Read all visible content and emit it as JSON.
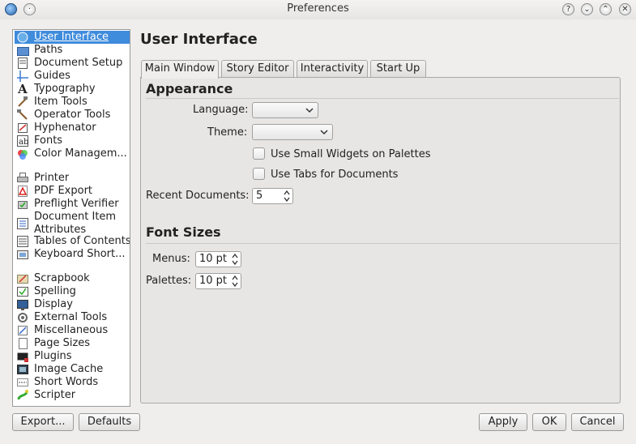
{
  "window": {
    "title": "Preferences",
    "buttons": [
      "?",
      "⌄",
      "⌃",
      "✕"
    ]
  },
  "sidebar": {
    "items": [
      {
        "label": "User Interface",
        "icon": "monitor-icon",
        "selected": true
      },
      {
        "label": "Paths",
        "icon": "folder-icon"
      },
      {
        "label": "Document Setup",
        "icon": "document-icon"
      },
      {
        "label": "Guides",
        "icon": "guides-icon"
      },
      {
        "label": "Typography",
        "icon": "typography-icon"
      },
      {
        "label": "Item Tools",
        "icon": "item-tools-icon"
      },
      {
        "label": "Operator Tools",
        "icon": "operator-tools-icon"
      },
      {
        "label": "Hyphenator",
        "icon": "hyphenator-icon"
      },
      {
        "label": "Fonts",
        "icon": "fonts-icon"
      },
      {
        "label": "Color Managem...",
        "icon": "color-management-icon"
      },
      {
        "label": "Printer",
        "icon": "printer-icon"
      },
      {
        "label": "PDF Export",
        "icon": "pdf-icon"
      },
      {
        "label": "Preflight Verifier",
        "icon": "preflight-icon"
      },
      {
        "label": "Document Item",
        "label2": "Attributes",
        "icon": "attributes-icon"
      },
      {
        "label": "Tables of Contents",
        "icon": "toc-icon"
      },
      {
        "label": "Keyboard Short...",
        "icon": "keyboard-icon"
      },
      {
        "label": "Scrapbook",
        "icon": "scrapbook-icon"
      },
      {
        "label": "Spelling",
        "icon": "spelling-icon"
      },
      {
        "label": "Display",
        "icon": "display-icon"
      },
      {
        "label": "External Tools",
        "icon": "external-tools-icon"
      },
      {
        "label": "Miscellaneous",
        "icon": "miscellaneous-icon"
      },
      {
        "label": "Page Sizes",
        "icon": "page-sizes-icon"
      },
      {
        "label": "Plugins",
        "icon": "plugins-icon"
      },
      {
        "label": "Image Cache",
        "icon": "image-cache-icon"
      },
      {
        "label": "Short Words",
        "icon": "short-words-icon"
      },
      {
        "label": "Scripter",
        "icon": "scripter-icon"
      }
    ]
  },
  "main": {
    "title": "User Interface",
    "tabs": [
      {
        "label": "Main Window",
        "active": true
      },
      {
        "label": "Story Editor"
      },
      {
        "label": "Interactivity"
      },
      {
        "label": "Start Up"
      }
    ],
    "appearance": {
      "title": "Appearance",
      "language_label": "Language:",
      "language_value": "",
      "theme_label": "Theme:",
      "theme_value": "",
      "small_widgets_label": "Use Small Widgets on Palettes",
      "small_widgets_checked": false,
      "tabs_docs_label": "Use Tabs for Documents",
      "tabs_docs_checked": false,
      "recent_label": "Recent Documents:",
      "recent_value": "5"
    },
    "font_sizes": {
      "title": "Font Sizes",
      "menus_label": "Menus:",
      "menus_value": "10 pt",
      "palettes_label": "Palettes:",
      "palettes_value": "10 pt"
    }
  },
  "footer": {
    "export_label": "Export...",
    "defaults_label": "Defaults",
    "apply_label": "Apply",
    "ok_label": "OK",
    "cancel_label": "Cancel"
  },
  "colors": {
    "selection": "#3f8bdc",
    "window_bg": "#efeeed"
  }
}
